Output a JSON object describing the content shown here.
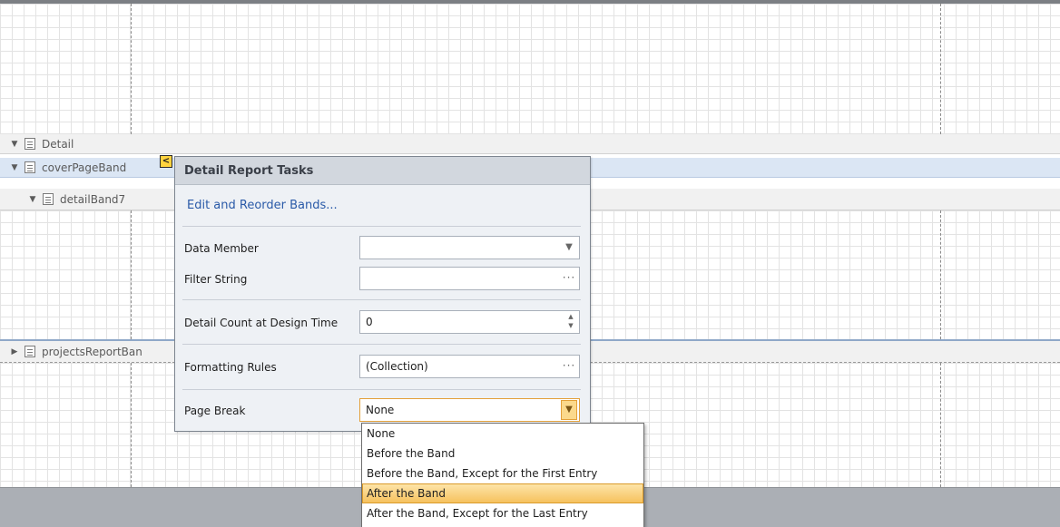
{
  "bands": {
    "detail": "Detail",
    "cover": "coverPageBand",
    "detail7": "detailBand7",
    "projects": "projectsReportBan"
  },
  "smart_tag": {
    "glyph": "<"
  },
  "tasks_panel": {
    "title": "Detail Report Tasks",
    "link": "Edit and Reorder Bands...",
    "data_member": {
      "label": "Data Member",
      "value": ""
    },
    "filter_string": {
      "label": "Filter String",
      "value": ""
    },
    "detail_count": {
      "label": "Detail Count at Design Time",
      "value": "0"
    },
    "formatting_rules": {
      "label": "Formatting Rules",
      "value": "(Collection)"
    },
    "page_break": {
      "label": "Page Break",
      "value": "None"
    },
    "dots_glyph": "···"
  },
  "page_break_options": [
    "None",
    "Before the Band",
    "Before the Band, Except for the First Entry",
    "After the Band",
    "After the Band, Except for the Last Entry"
  ],
  "selected_option": "After the Band",
  "icons": {
    "expanded": "▼",
    "collapsed": "▶"
  }
}
